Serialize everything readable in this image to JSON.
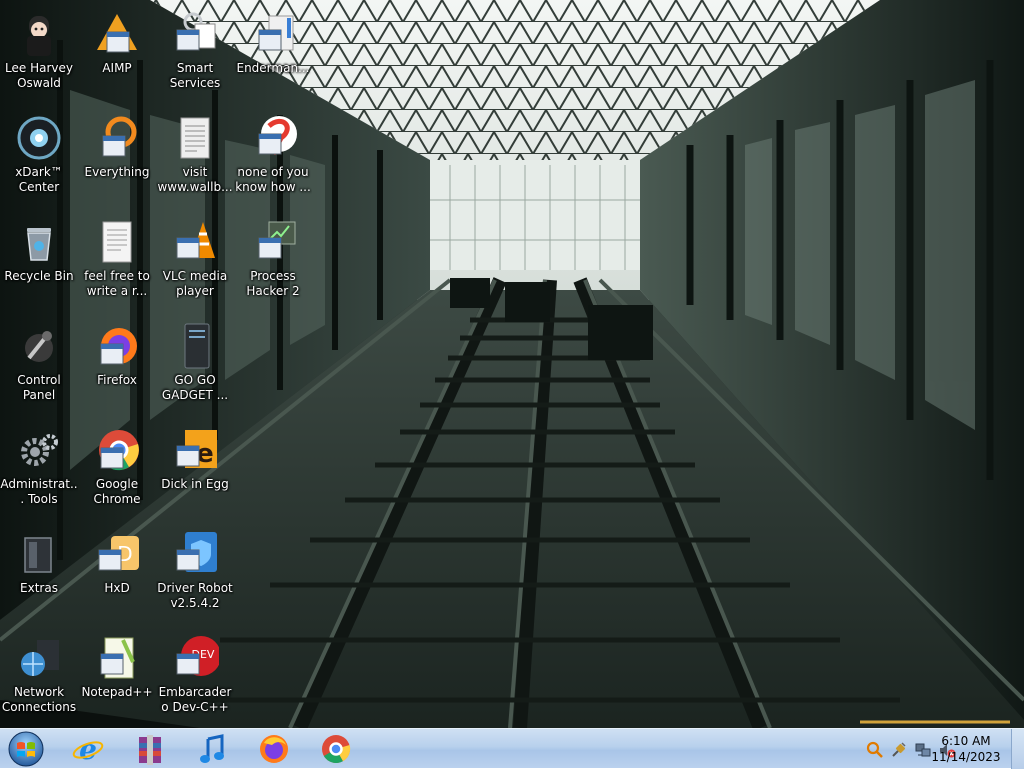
{
  "desktop": {
    "icons": [
      {
        "id": "lee-harvey-oswald",
        "label": "Lee Harvey Oswald",
        "icon": "anime-avatar-icon"
      },
      {
        "id": "xdark-center",
        "label": "xDark™ Center",
        "icon": "xdark-orb-icon"
      },
      {
        "id": "recycle-bin",
        "label": "Recycle Bin",
        "icon": "recycle-bin-icon"
      },
      {
        "id": "control-panel",
        "label": "Control Panel",
        "icon": "control-panel-icon"
      },
      {
        "id": "administrative-tools",
        "label": "Administrat... Tools",
        "icon": "gears-icon"
      },
      {
        "id": "extras",
        "label": "Extras",
        "icon": "folder-icon"
      },
      {
        "id": "network-connections",
        "label": "Network Connections",
        "icon": "network-globe-icon"
      },
      {
        "id": "aimp",
        "label": "AIMP",
        "icon": "aimp-icon"
      },
      {
        "id": "everything",
        "label": "Everything",
        "icon": "everything-icon"
      },
      {
        "id": "feel-free",
        "label": "feel free to write a r...",
        "icon": "text-document-icon"
      },
      {
        "id": "firefox",
        "label": "Firefox",
        "icon": "firefox-icon"
      },
      {
        "id": "google-chrome",
        "label": "Google Chrome",
        "icon": "chrome-icon"
      },
      {
        "id": "hxd",
        "label": "HxD",
        "icon": "hxd-icon"
      },
      {
        "id": "notepad-plus-plus",
        "label": "Notepad++",
        "icon": "notepadpp-icon"
      },
      {
        "id": "smart-services",
        "label": "Smart Services",
        "icon": "smart-services-icon"
      },
      {
        "id": "visit-wallb",
        "label": "visit www.wallb...",
        "icon": "text-document-icon"
      },
      {
        "id": "vlc-media-player",
        "label": "VLC media player",
        "icon": "vlc-cone-icon"
      },
      {
        "id": "go-go-gadget",
        "label": "GO GO GADGET ...",
        "icon": "gadget-tower-icon"
      },
      {
        "id": "dick-in-egg",
        "label": "Dick in Egg",
        "icon": "de-icon"
      },
      {
        "id": "driver-robot",
        "label": "Driver Robot v2.5.4.2",
        "icon": "driver-robot-icon"
      },
      {
        "id": "embarcadero-dev-cpp",
        "label": "Embarcadero Dev-C++",
        "icon": "devcpp-icon"
      },
      {
        "id": "enderman",
        "label": "Enderman...",
        "icon": "enderman-icon"
      },
      {
        "id": "none-of-you",
        "label": "none of you know how ...",
        "icon": "ribbon-icon"
      },
      {
        "id": "process-hacker-2",
        "label": "Process Hacker 2",
        "icon": "process-hacker-icon"
      }
    ]
  },
  "taskbar": {
    "start_icon": "windows-orb-icon",
    "pinned": [
      {
        "id": "internet-explorer",
        "icon": "internet-explorer-icon"
      },
      {
        "id": "winrar",
        "icon": "winrar-icon"
      },
      {
        "id": "music",
        "icon": "music-note-icon"
      },
      {
        "id": "firefox",
        "icon": "firefox-icon"
      },
      {
        "id": "chrome",
        "icon": "chrome-icon"
      }
    ],
    "tray": {
      "icons": [
        "search-tray-icon",
        "plug-tray-icon",
        "network-tray-icon",
        "volume-muted-icon"
      ],
      "time": "6:10 AM",
      "date": "11/14/2023"
    }
  },
  "colors": {
    "taskbar_top": "#cfe0f3",
    "taskbar_bottom": "#bad1ee",
    "wallpaper_dark": "#1d2722",
    "wallpaper_light": "#e6ece8"
  }
}
